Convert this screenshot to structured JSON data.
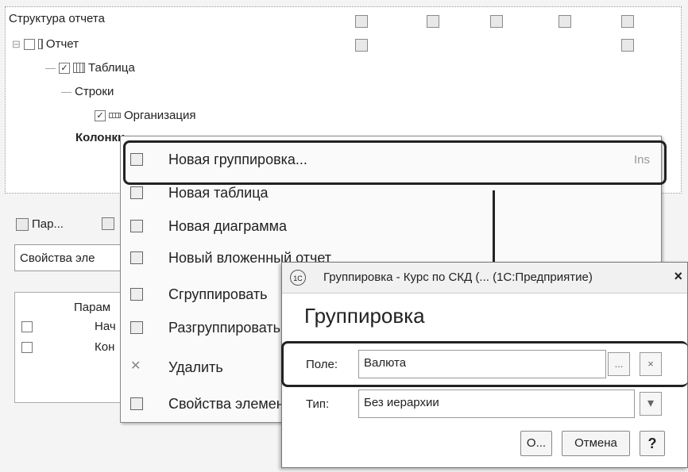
{
  "structure_panel": {
    "title": "Структура отчета",
    "tree": [
      {
        "label": "Отчет",
        "checked": false,
        "icon": "report-icon"
      },
      {
        "label": "Таблица",
        "checked": true,
        "icon": "table-icon"
      },
      {
        "label": "Строки"
      },
      {
        "label": "Организация",
        "checked": true,
        "icon": "grouping-icon"
      },
      {
        "label": "Колонки"
      }
    ]
  },
  "lower_panel": {
    "tabs": [
      {
        "label": "Пар..."
      },
      {
        "label": ""
      }
    ],
    "props_field": "Свойства эле",
    "params_header": "Парам",
    "params": [
      {
        "label": "Нач",
        "checked": false
      },
      {
        "label": "Кон",
        "checked": false
      }
    ]
  },
  "context_menu": {
    "items": [
      {
        "label": "Новая группировка...",
        "shortcut": "Ins",
        "icon": "new-grouping-icon"
      },
      {
        "label": "Новая таблица",
        "shortcut": "",
        "icon": "new-table-icon"
      },
      {
        "label": "Новая диаграмма",
        "shortcut": "",
        "icon": "new-chart-icon"
      },
      {
        "label": "Новый вложенный отчет",
        "shortcut": "",
        "icon": "nested-report-icon"
      },
      {
        "label": "Сгруппировать",
        "shortcut": "",
        "icon": "group-icon"
      },
      {
        "label": "Разгруппировать",
        "shortcut": "",
        "icon": "ungroup-icon"
      },
      {
        "label": "Удалить",
        "shortcut": "",
        "icon": "delete-icon"
      },
      {
        "label": "Свойства элемента",
        "shortcut": "",
        "icon": "properties-icon"
      }
    ]
  },
  "dialog": {
    "logo": "1С",
    "title": "Группировка - Курс по СКД (...  (1С:Предприятие)",
    "close": "×",
    "heading": "Группировка",
    "field_label": "Поле:",
    "field_value": "Валюта",
    "choose_btn": "...",
    "clear_btn": "×",
    "type_label": "Тип:",
    "type_value": "Без иерархии",
    "type_dropdown": "▾",
    "ok_label": "О...",
    "cancel_label": "Отмена",
    "help_label": "?"
  }
}
